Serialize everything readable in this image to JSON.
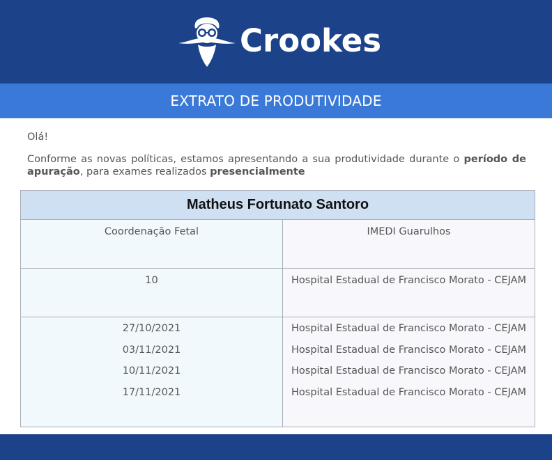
{
  "header": {
    "brand": "Crookes",
    "banner_title": "EXTRATO DE PRODUTIVIDADE"
  },
  "message": {
    "greeting": "Olá!",
    "intro_part1": "Conforme as novas políticas, estamos apresentando a sua produtividade durante o ",
    "intro_bold1": "período de apuração",
    "intro_part2": ", para exames realizados ",
    "intro_bold2": "presencialmente"
  },
  "report": {
    "name": "Matheus Fortunato Santoro",
    "row1": {
      "left": "Coordenação Fetal",
      "right": "IMEDI Guarulhos"
    },
    "row2": {
      "left": "10",
      "right": "Hospital Estadual de Francisco Morato - CEJAM"
    },
    "entries": [
      {
        "date": "27/10/2021",
        "place": "Hospital Estadual de Francisco Morato - CEJAM"
      },
      {
        "date": "03/11/2021",
        "place": "Hospital Estadual de Francisco Morato - CEJAM"
      },
      {
        "date": "10/11/2021",
        "place": "Hospital Estadual de Francisco Morato - CEJAM"
      },
      {
        "date": "17/11/2021",
        "place": "Hospital Estadual de Francisco Morato - CEJAM"
      }
    ]
  },
  "colors": {
    "header_bg": "#1c4289",
    "banner_bg": "#3a79d8",
    "title_bg": "#cfe0f3"
  },
  "icons": {
    "logo": "bearded-scientist-logo-icon"
  }
}
